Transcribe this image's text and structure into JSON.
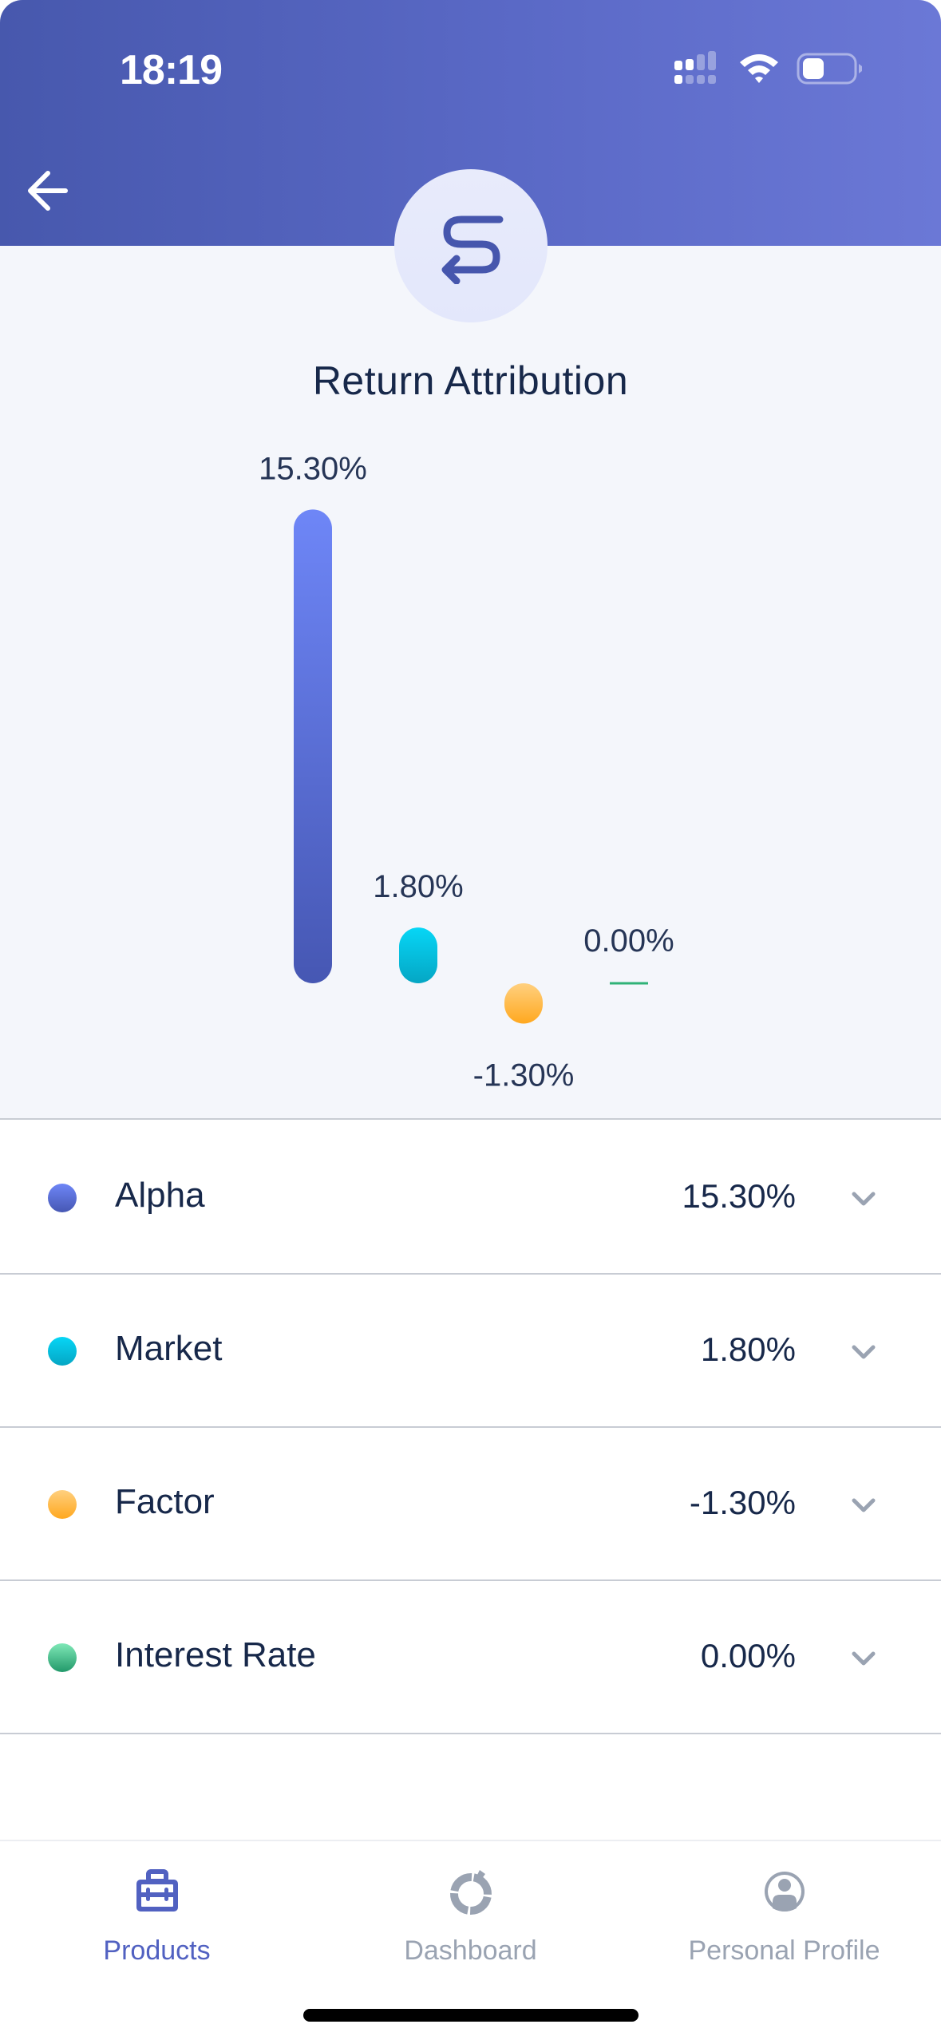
{
  "status_bar": {
    "time": "18:19",
    "icons": [
      "cellular-signal-icon",
      "wifi-icon",
      "battery-icon"
    ]
  },
  "header": {
    "back_icon": "arrow-left-icon",
    "hero_icon": "return-route-icon",
    "title": "Return Attribution"
  },
  "colors": {
    "header_start": "#4758ad",
    "header_end": "#6b78d6",
    "accent": "#5161c1",
    "inactive": "#9aa3b2",
    "text": "#17284a",
    "alpha": "#5b6bd6",
    "market": "#06c8e6",
    "factor": "#ffb74a",
    "interest_rate": "#3dbf82"
  },
  "chart_data": {
    "type": "bar",
    "title": "Return Attribution",
    "categories": [
      "Alpha",
      "Market",
      "Factor",
      "Interest Rate"
    ],
    "values": [
      15.3,
      1.8,
      -1.3,
      0.0
    ],
    "value_labels": [
      "15.30%",
      "1.80%",
      "-1.30%",
      "0.00%"
    ],
    "unit": "%",
    "xlabel": "",
    "ylabel": "",
    "grid": false,
    "legend": "none",
    "series_colors": [
      [
        "#6e86f7",
        "#4657b3"
      ],
      [
        "#06d6f6",
        "#05a6c4"
      ],
      [
        "#ffd07f",
        "#ffa81f"
      ],
      [
        "#5ad69c",
        "#2fb277"
      ]
    ]
  },
  "list": {
    "items": [
      {
        "label": "Alpha",
        "value": "15.30%",
        "color_top": "#6e86f7",
        "color_bottom": "#4657b3"
      },
      {
        "label": "Market",
        "value": "1.80%",
        "color_top": "#06d6f6",
        "color_bottom": "#05a6c4"
      },
      {
        "label": "Factor",
        "value": "-1.30%",
        "color_top": "#ffd07f",
        "color_bottom": "#ffa81f"
      },
      {
        "label": "Interest Rate",
        "value": "0.00%",
        "color_top": "#7fe8b7",
        "color_bottom": "#22996a"
      }
    ],
    "expand_icon": "chevron-down-icon"
  },
  "tabbar": {
    "tabs": [
      {
        "label": "Products",
        "icon": "briefcase-icon",
        "active": true
      },
      {
        "label": "Dashboard",
        "icon": "donut-chart-icon",
        "active": false
      },
      {
        "label": "Personal Profile",
        "icon": "user-circle-icon",
        "active": false
      }
    ]
  }
}
